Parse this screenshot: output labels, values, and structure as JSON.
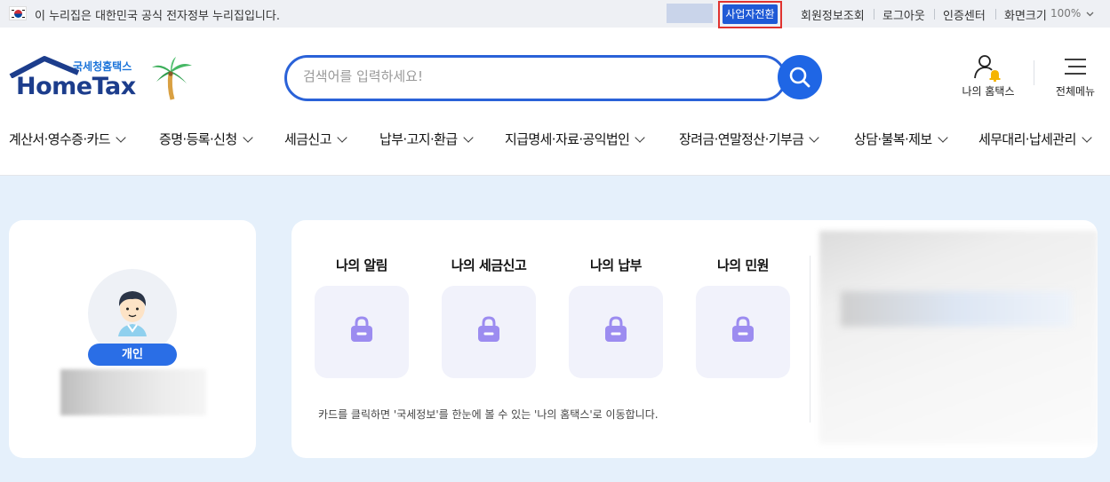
{
  "topbar": {
    "gov_notice": "이 누리집은 대한민국 공식 전자정부 누리집입니다.",
    "switch_business": "사업자전환",
    "member_info": "회원정보조회",
    "logout": "로그아웃",
    "cert_center": "인증센터",
    "screen_size_label": "화면크기",
    "zoom_value": "100%"
  },
  "header": {
    "logo_sub": "국세청홈택스",
    "logo_main": "HomeTax",
    "search_placeholder": "검색어를 입력하세요!",
    "my_hometax": "나의 홈택스",
    "all_menu": "전체메뉴"
  },
  "nav": {
    "items": [
      {
        "label": "계산서·영수증·카드"
      },
      {
        "label": "증명·등록·신청"
      },
      {
        "label": "세금신고"
      },
      {
        "label": "납부·고지·환급"
      },
      {
        "label": "지급명세·자료·공익법인"
      },
      {
        "label": "장려금·연말정산·기부금"
      },
      {
        "label": "상담·불복·제보"
      },
      {
        "label": "세무대리·납세관리"
      }
    ]
  },
  "profile": {
    "badge": "개인"
  },
  "cards": {
    "items": [
      {
        "title": "나의 알림"
      },
      {
        "title": "나의 세금신고"
      },
      {
        "title": "나의 납부"
      },
      {
        "title": "나의 민원"
      }
    ],
    "note": "카드를 클릭하면 '국세정보'를 한눈에 볼 수 있는 '나의 홈택스'로 이동합니다."
  },
  "colors": {
    "accent": "#1f66e5",
    "highlight_border": "#e0332f",
    "lock_purple": "#9c8cf0",
    "main_bg": "#e5f0fb"
  }
}
